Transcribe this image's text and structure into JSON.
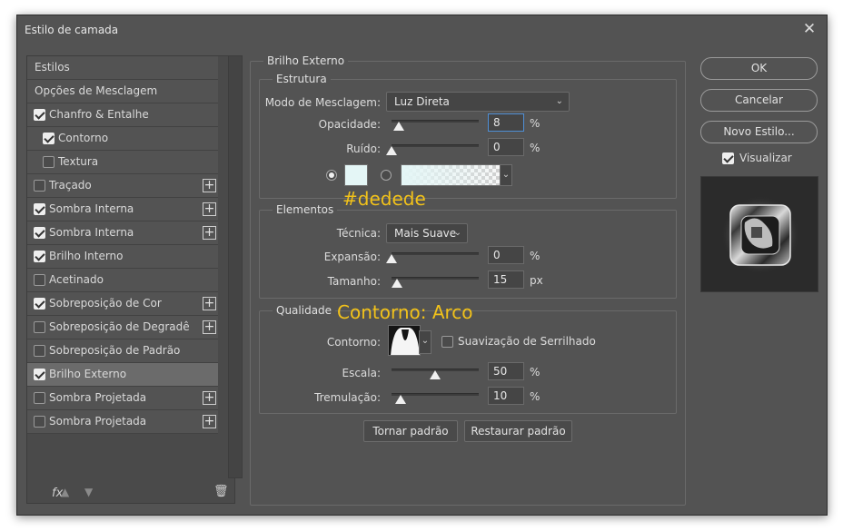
{
  "window": {
    "title": "Estilo de camada"
  },
  "styles_list": {
    "items": [
      {
        "label": "Estilos",
        "checkbox": null,
        "plus": false,
        "indent": "none",
        "selected": false
      },
      {
        "label": "Opções de Mesclagem",
        "checkbox": null,
        "plus": false,
        "indent": "none",
        "selected": false
      },
      {
        "label": "Chanfro & Entalhe",
        "checkbox": true,
        "plus": false,
        "indent": "top",
        "selected": false
      },
      {
        "label": "Contorno",
        "checkbox": true,
        "plus": false,
        "indent": "sub",
        "selected": false
      },
      {
        "label": "Textura",
        "checkbox": false,
        "plus": false,
        "indent": "sub",
        "selected": false
      },
      {
        "label": "Traçado",
        "checkbox": false,
        "plus": true,
        "indent": "top",
        "selected": false
      },
      {
        "label": "Sombra Interna",
        "checkbox": true,
        "plus": true,
        "indent": "top",
        "selected": false
      },
      {
        "label": "Sombra Interna",
        "checkbox": true,
        "plus": true,
        "indent": "top",
        "selected": false
      },
      {
        "label": "Brilho Interno",
        "checkbox": true,
        "plus": false,
        "indent": "top",
        "selected": false
      },
      {
        "label": "Acetinado",
        "checkbox": false,
        "plus": false,
        "indent": "top",
        "selected": false
      },
      {
        "label": "Sobreposição de Cor",
        "checkbox": true,
        "plus": true,
        "indent": "top",
        "selected": false
      },
      {
        "label": "Sobreposição de Degradê",
        "checkbox": false,
        "plus": true,
        "indent": "top",
        "selected": false
      },
      {
        "label": "Sobreposição de Padrão",
        "checkbox": false,
        "plus": false,
        "indent": "top",
        "selected": false
      },
      {
        "label": "Brilho Externo",
        "checkbox": true,
        "plus": false,
        "indent": "top",
        "selected": true
      },
      {
        "label": "Sombra Projetada",
        "checkbox": false,
        "plus": true,
        "indent": "top",
        "selected": false
      },
      {
        "label": "Sombra Projetada",
        "checkbox": false,
        "plus": true,
        "indent": "top",
        "selected": false
      }
    ],
    "footer": {
      "fx_label": "fx"
    }
  },
  "panel": {
    "title": "Brilho Externo",
    "structure": {
      "title": "Estrutura",
      "blend_mode": {
        "label": "Modo de Mesclagem:",
        "value": "Luz Direta"
      },
      "opacity": {
        "label": "Opacidade:",
        "value": "8",
        "unit": "%",
        "fraction": 0.08
      },
      "noise": {
        "label": "Ruído:",
        "value": "0",
        "unit": "%",
        "fraction": 0.0
      },
      "solid_color": "#e4f6f6",
      "color_mode": "solid"
    },
    "elements": {
      "title": "Elementos",
      "technique": {
        "label": "Técnica:",
        "value": "Mais Suave"
      },
      "spread": {
        "label": "Expansão:",
        "value": "0",
        "unit": "%",
        "fraction": 0.0
      },
      "size": {
        "label": "Tamanho:",
        "value": "15",
        "unit": "px",
        "fraction": 0.06
      }
    },
    "quality": {
      "title": "Qualidade",
      "contour": {
        "label": "Contorno:"
      },
      "anti_alias": {
        "label": "Suavização de Serrilhado",
        "checked": false
      },
      "range": {
        "label": "Escala:",
        "value": "50",
        "unit": "%",
        "fraction": 0.5
      },
      "jitter": {
        "label": "Tremulação:",
        "value": "10",
        "unit": "%",
        "fraction": 0.1
      }
    },
    "buttons": {
      "make_default": "Tornar padrão",
      "reset_default": "Restaurar padrão"
    }
  },
  "annotations": {
    "color_note": "#dedede",
    "contour_note": "Contorno: Arco"
  },
  "actions": {
    "ok": "OK",
    "cancel": "Cancelar",
    "new_style": "Novo Estilo...",
    "preview": {
      "label": "Visualizar",
      "checked": true
    }
  },
  "icons": {
    "close": "close-icon",
    "delete": "trash-icon",
    "move_up": "arrow-up-icon",
    "move_down": "arrow-down-icon"
  },
  "colors": {
    "dialog_bg": "#535353",
    "annotation": "#f2c21a",
    "focus": "#4f8fd6"
  }
}
